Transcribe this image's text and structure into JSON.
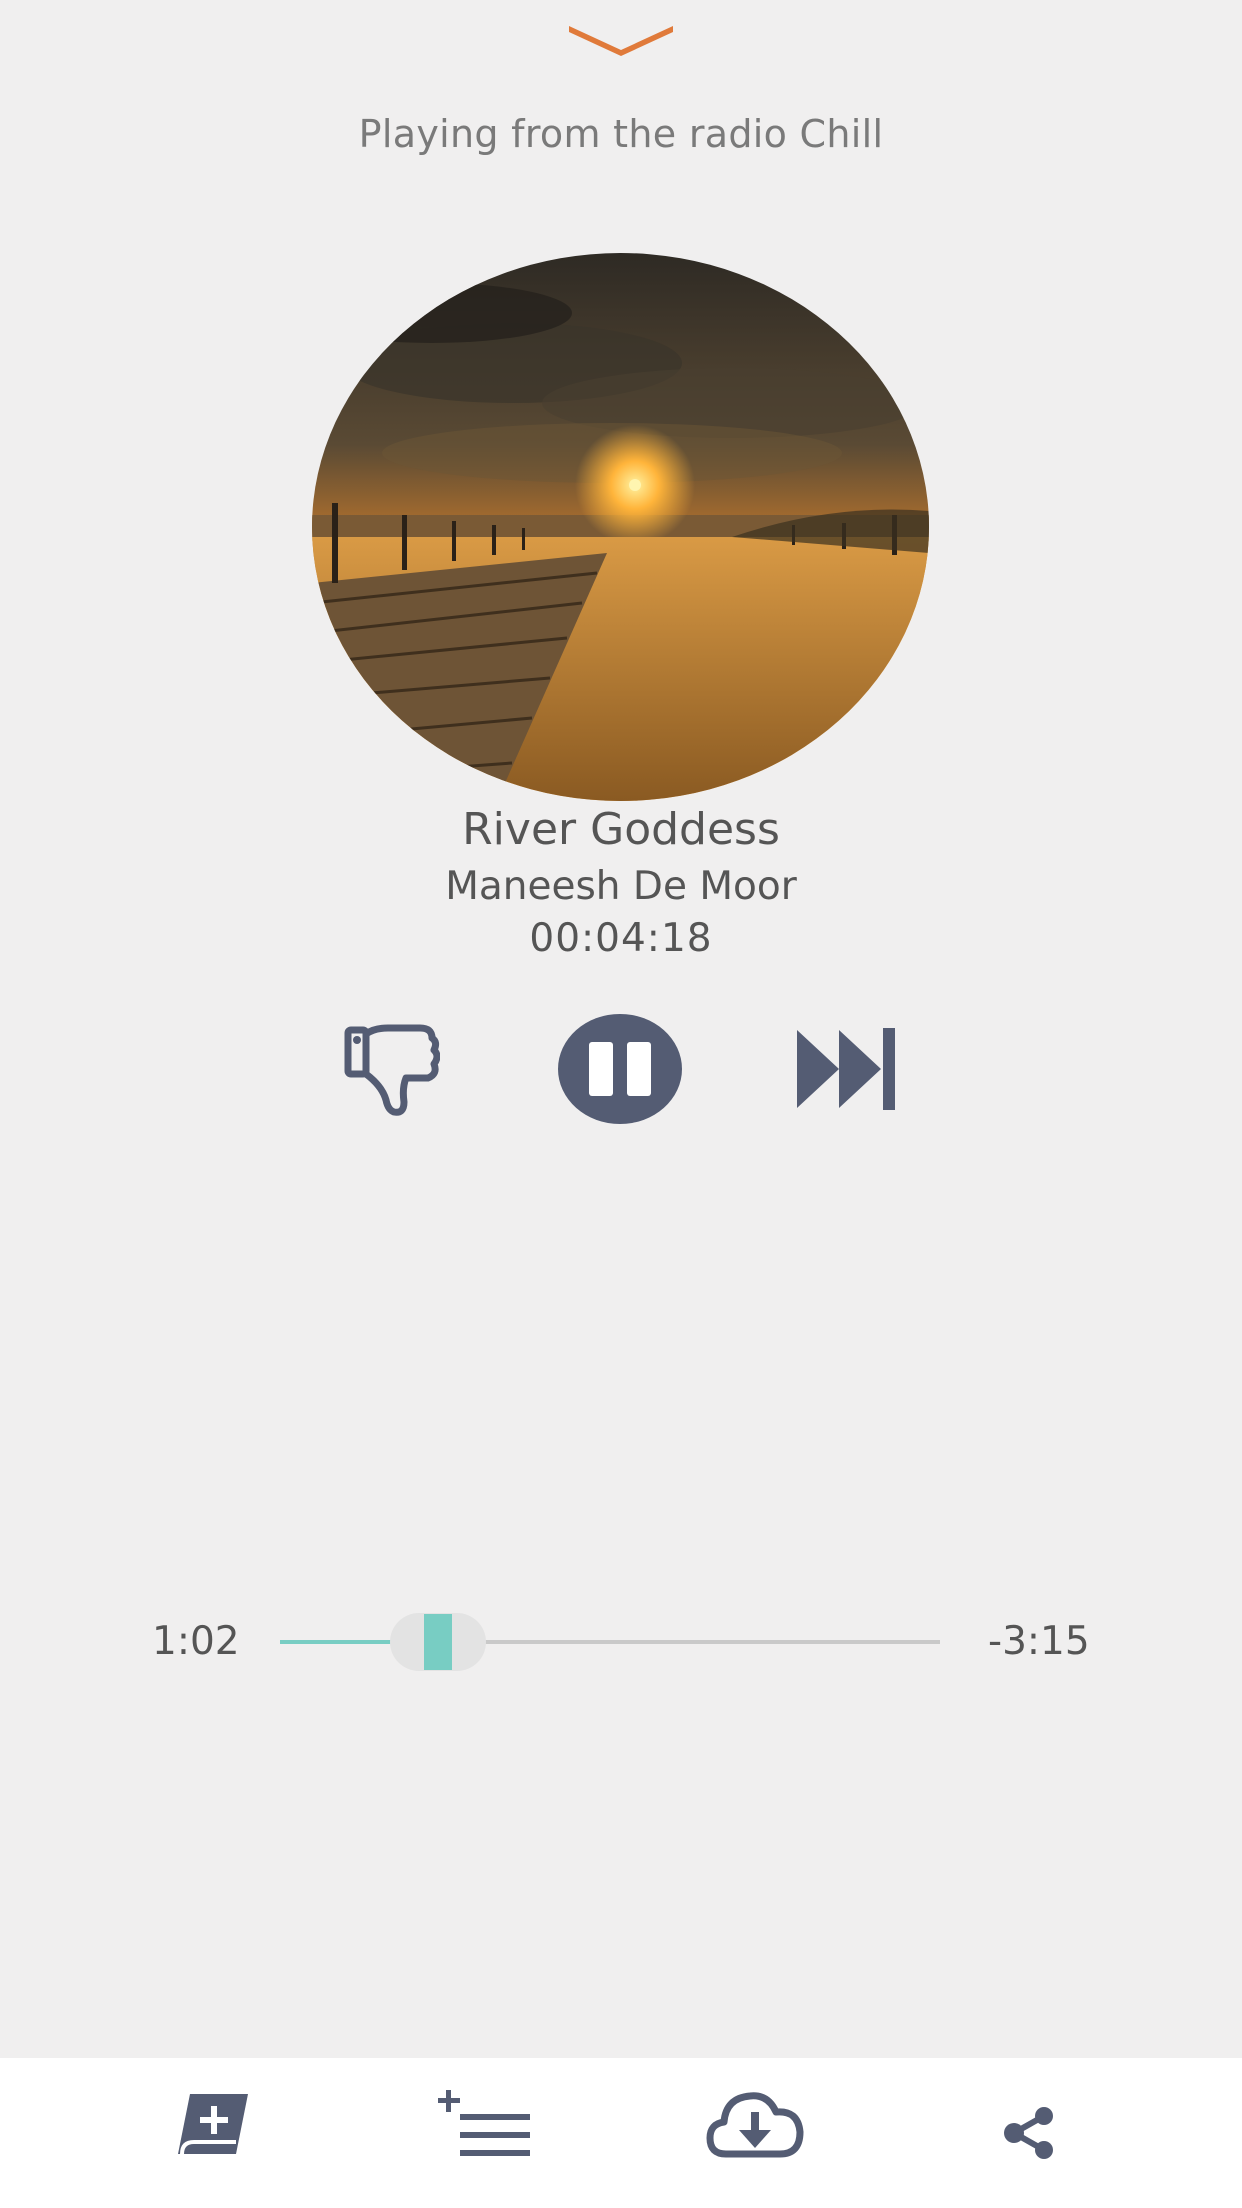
{
  "header": {
    "collapse_icon": "chevron-down-icon",
    "source_text": "Playing from the radio Chill"
  },
  "track": {
    "artwork": "sunset-beach-boardwalk",
    "title": "River Goddess",
    "artist": "Maneesh De Moor",
    "duration": "00:04:18"
  },
  "controls": {
    "dislike_icon": "thumbs-down-icon",
    "pause_icon": "pause-icon",
    "next_icon": "skip-next-icon"
  },
  "progress": {
    "elapsed": "1:02",
    "remaining": "-3:15",
    "fraction": 0.24
  },
  "bottom_bar": {
    "add_icon": "add-to-library-icon",
    "queue_icon": "add-to-queue-icon",
    "download_icon": "cloud-download-icon",
    "share_icon": "share-icon"
  },
  "colors": {
    "accent_orange": "#e07a3a",
    "icon_slate": "#545c73",
    "progress_teal": "#78cdc3",
    "background": "#f0efef"
  }
}
